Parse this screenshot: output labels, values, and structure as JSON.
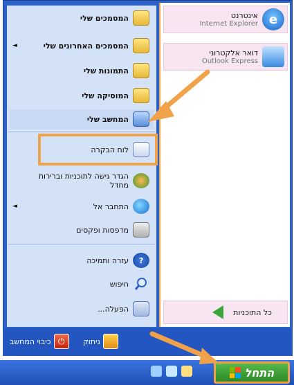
{
  "pinned": [
    {
      "title": "אינטרנט",
      "subtitle": "Internet Explorer",
      "icon": "internet-explorer-icon"
    },
    {
      "title": "דואר אלקטרוני",
      "subtitle": "Outlook Express",
      "icon": "outlook-express-icon"
    }
  ],
  "all_programs": {
    "label": "כל התוכניות",
    "icon": "green-arrow-icon"
  },
  "right_items": [
    {
      "label": "המסמכים שלי",
      "icon": "folder-icon",
      "bold": true
    },
    {
      "label": "המסמכים האחרונים שלי",
      "icon": "recent-documents-icon",
      "bold": true,
      "submenu": true
    },
    {
      "label": "התמונות שלי",
      "icon": "pictures-folder-icon",
      "bold": true
    },
    {
      "label": "המוסיקה שלי",
      "icon": "music-folder-icon",
      "bold": true
    },
    {
      "label": "המחשב שלי",
      "icon": "my-computer-icon",
      "bold": true
    },
    {
      "label": "לוח הבקרה",
      "icon": "control-panel-icon",
      "bold": false
    },
    {
      "label": "הגדר גישה לתוכניות וברירות מחדל",
      "icon": "program-access-icon",
      "bold": false
    },
    {
      "label": "התחבר אל",
      "icon": "connect-to-icon",
      "bold": false,
      "submenu": true
    },
    {
      "label": "מדפסות ופקסים",
      "icon": "printer-icon",
      "bold": false
    },
    {
      "label": "עזרה ותמיכה",
      "icon": "help-icon",
      "bold": false
    },
    {
      "label": "חיפוש",
      "icon": "search-icon",
      "bold": false
    },
    {
      "label": "הפעלה...",
      "icon": "run-icon",
      "bold": false
    }
  ],
  "bottom": {
    "log_off": "ניתוק",
    "turn_off": "כיבוי המחשב"
  },
  "taskbar": {
    "start_label": "התחל"
  },
  "colors": {
    "accent_orange": "#f0a24b",
    "menu_blue": "#2d62c8",
    "left_column": "#d4e2f7",
    "start_green": "#3a9a33"
  }
}
